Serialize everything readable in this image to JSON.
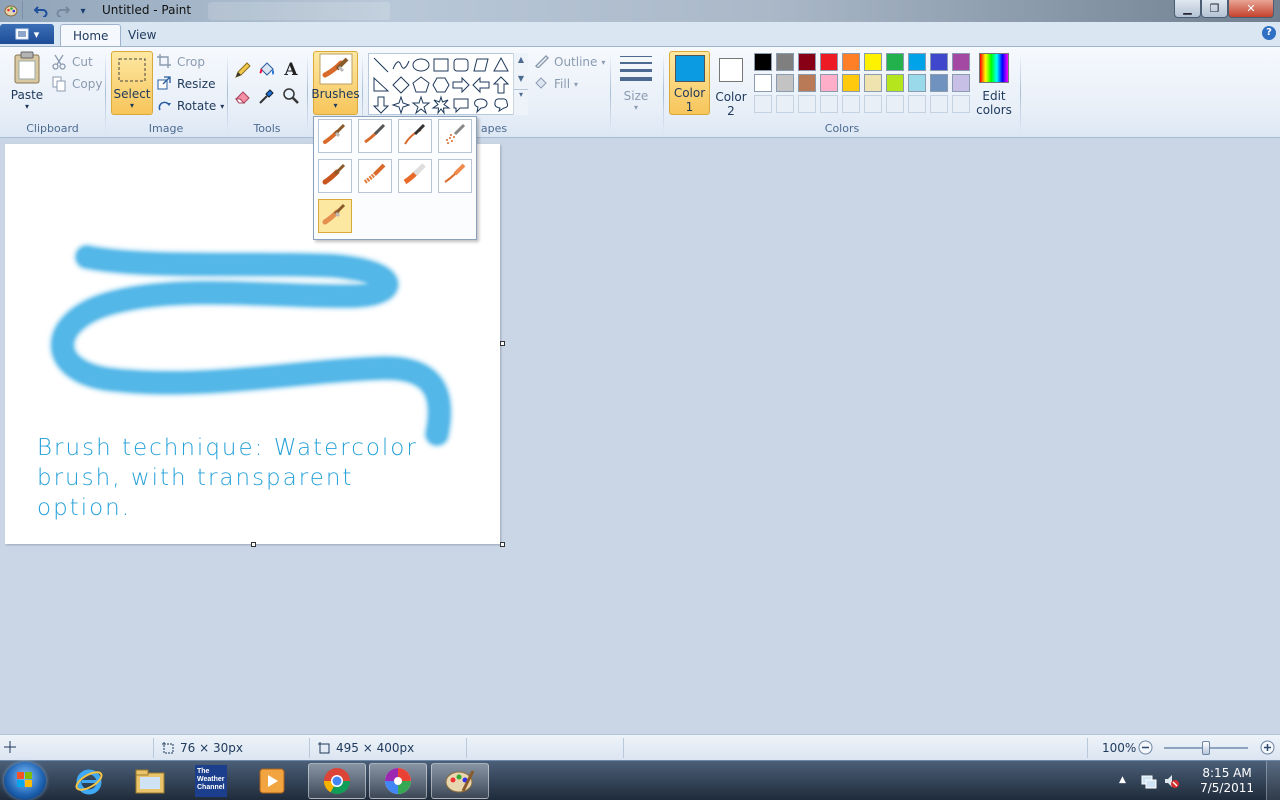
{
  "window": {
    "title": "Untitled - Paint"
  },
  "tabs": {
    "home": "Home",
    "view": "View"
  },
  "clipboard": {
    "paste": "Paste",
    "cut": "Cut",
    "copy": "Copy",
    "label": "Clipboard"
  },
  "image": {
    "select": "Select",
    "crop": "Crop",
    "resize": "Resize",
    "rotate": "Rotate",
    "label": "Image"
  },
  "tools": {
    "label": "Tools"
  },
  "brushes": {
    "label": "Brushes"
  },
  "shapes": {
    "outline": "Outline",
    "fill": "Fill",
    "label_partial": "apes"
  },
  "size": {
    "label": "Size"
  },
  "colors": {
    "color1_line1": "Color",
    "color1_line2": "1",
    "color2_line1": "Color",
    "color2_line2": "2",
    "edit_line1": "Edit",
    "edit_line2": "colors",
    "label": "Colors",
    "color1_value": "#0a9be3",
    "color2_value": "#ffffff",
    "palette_row1": [
      "#000000",
      "#7f7f7f",
      "#880015",
      "#ed1c24",
      "#ff7f27",
      "#fff200",
      "#22b14c",
      "#00a2e8",
      "#3f48cc",
      "#a349a4"
    ],
    "palette_row2": [
      "#ffffff",
      "#c3c3c3",
      "#b97a57",
      "#ffaec9",
      "#ffc90e",
      "#efe4b0",
      "#b5e61d",
      "#99d9ea",
      "#7092be",
      "#c8bfe7"
    ]
  },
  "canvas": {
    "text_line1": "Brush technique: Watercolor",
    "text_line2": "brush, with transparent",
    "text_line3": "option.",
    "stroke_color": "#2aa7e3"
  },
  "status": {
    "selection_size": "76 × 30px",
    "canvas_size": "495 × 400px",
    "zoom": "100%",
    "zoom_fraction": 0.5
  },
  "taskbar": {
    "time": "8:15 AM",
    "date": "7/5/2011",
    "weather_line1": "The",
    "weather_line2": "Weather",
    "weather_line3": "Channel"
  }
}
